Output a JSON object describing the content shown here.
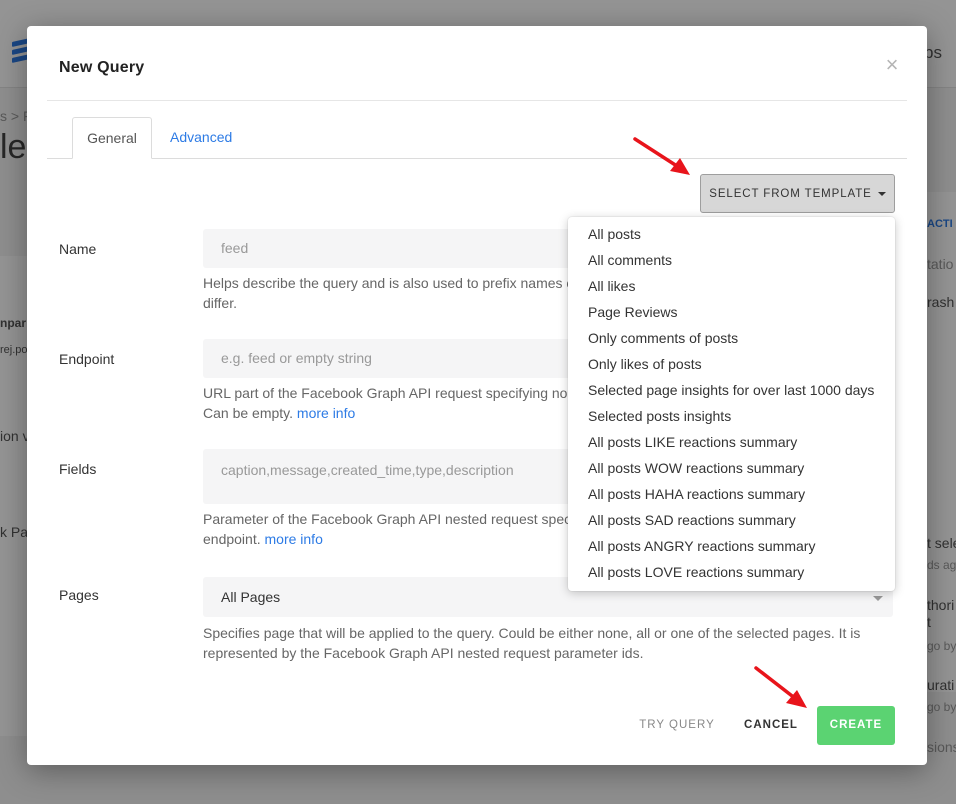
{
  "background": {
    "top_right_text": "bs",
    "breadcrumb_fragment": "s  >  F",
    "heading_fragment": "le",
    "left_fragments": [
      "npar",
      "rej.po",
      "ion v",
      "k Pag"
    ],
    "right_fragments": [
      "ACTI",
      "tatio",
      "rash",
      "t sele",
      "ds ag",
      "thori",
      "t",
      "go by",
      "urati",
      "go by",
      "sions"
    ]
  },
  "modal": {
    "title": "New Query",
    "close_glyph": "×",
    "tabs": [
      {
        "label": "General",
        "active": true
      },
      {
        "label": "Advanced",
        "active": false
      }
    ],
    "template_button": "SELECT FROM TEMPLATE",
    "template_options": [
      "All posts",
      "All comments",
      "All likes",
      "Page Reviews",
      "Only comments of posts",
      "Only likes of posts",
      "Selected page insights for over last 1000 days",
      "Selected posts insights",
      "All posts LIKE reactions summary",
      "All posts WOW reactions summary",
      "All posts HAHA reactions summary",
      "All posts SAD reactions summary",
      "All posts ANGRY reactions summary",
      "All posts LOVE reactions summary"
    ],
    "fields": {
      "name": {
        "label": "Name",
        "placeholder": "feed",
        "help_line1": "Helps describe the query and is also used to prefix names o",
        "help_line2": "differ."
      },
      "endpoint": {
        "label": "Endpoint",
        "placeholder": "e.g. feed or empty string",
        "help_line1": "URL part of the Facebook Graph API request specifying noc",
        "help_line2": "Can be empty.",
        "link": "more info"
      },
      "fields": {
        "label": "Fields",
        "placeholder": "caption,message,created_time,type,description",
        "help_line1": "Parameter of the Facebook Graph API nested request spec",
        "help_line2": "endpoint.",
        "link": "more info"
      },
      "pages": {
        "label": "Pages",
        "value": "All Pages",
        "help_line1": "Specifies page that will be applied to the query. Could be either none, all or one of the selected pages. It is",
        "help_line2": "represented by the Facebook Graph API nested request parameter ids."
      }
    },
    "footer": {
      "try_query": "TRY QUERY",
      "cancel": "CANCEL",
      "create": "CREATE"
    }
  },
  "colors": {
    "accent_blue": "#2d7be5",
    "create_green": "#5bd372",
    "annotation_red": "#e8141b"
  }
}
